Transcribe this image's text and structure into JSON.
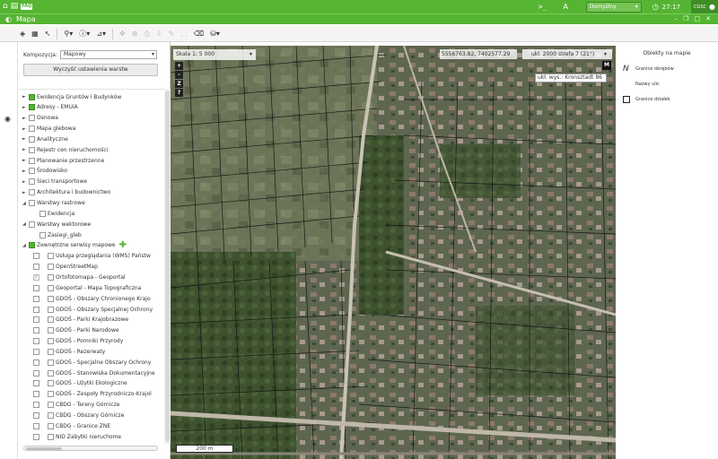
{
  "topbar": {
    "home_icon": "home-icon",
    "map_icon": "map-icon",
    "faq_label": "FAQ",
    "font_label": "A",
    "profile_label": "Domyślny",
    "time": "27:17",
    "user_label": "CGSC"
  },
  "titlebar": {
    "title": "Mapa"
  },
  "toolbar": {
    "icons": [
      "layers-icon",
      "table-icon",
      "pointer-icon",
      "search-icon",
      "info-icon",
      "measure-icon",
      "pan-icon",
      "zoom-icon",
      "print-icon",
      "export-icon",
      "draw-icon",
      "select-icon",
      "clear-icon",
      "database-icon"
    ]
  },
  "panel": {
    "kompozycja_label": "Kompozycja",
    "kompozycja_value": "Mapowy",
    "reset_button": "Wyczyść ustawienia warstw",
    "tree": [
      {
        "label": "Ewidencja Gruntów i Budynków",
        "toggle": "►",
        "check": "green",
        "indent": 0
      },
      {
        "label": "Adresy - EMUiA",
        "toggle": "►",
        "check": "green",
        "indent": 0
      },
      {
        "label": "Osnowa",
        "toggle": "►",
        "check": "empty",
        "indent": 0
      },
      {
        "label": "Mapa glebowa",
        "toggle": "►",
        "check": "empty",
        "indent": 0
      },
      {
        "label": "Analityczne",
        "toggle": "►",
        "check": "empty",
        "indent": 0
      },
      {
        "label": "Rejestr cen nieruchomości",
        "toggle": "►",
        "check": "empty",
        "indent": 0
      },
      {
        "label": "Planowanie przestrzenne",
        "toggle": "►",
        "check": "empty",
        "indent": 0
      },
      {
        "label": "Środowisko",
        "toggle": "►",
        "check": "empty",
        "indent": 0
      },
      {
        "label": "Sieci transportowe",
        "toggle": "►",
        "check": "empty",
        "indent": 0
      },
      {
        "label": "Architektura i budownictwo",
        "toggle": "►",
        "check": "empty",
        "indent": 0
      },
      {
        "label": "Warstwy rastrowe",
        "toggle": "◢",
        "check": "empty",
        "indent": 0
      },
      {
        "label": "Ewidencja",
        "toggle": "",
        "check": "empty",
        "indent": 1
      },
      {
        "label": "Warstwy wektorowe",
        "toggle": "◢",
        "check": "empty",
        "indent": 0
      },
      {
        "label": "Zasiegi_gleb",
        "toggle": "",
        "check": "empty",
        "indent": 1
      },
      {
        "label": "Zewnętrzne serwisy mapowe",
        "toggle": "◢",
        "check": "green",
        "indent": 0,
        "plus": "✚"
      },
      {
        "label": "Usługa przeglądania (WMS) Państw",
        "toggle": "",
        "check": "empty",
        "indent": 1,
        "pre": "empty"
      },
      {
        "label": "OpenStreetMap",
        "toggle": "",
        "check": "empty",
        "indent": 1,
        "pre": "empty"
      },
      {
        "label": "Ortofotomapa - Geoportal",
        "toggle": "",
        "check": "empty",
        "indent": 1,
        "pre": "gray"
      },
      {
        "label": "Geoportal - Mapa Topograficzna",
        "toggle": "",
        "check": "empty",
        "indent": 1,
        "pre": "empty"
      },
      {
        "label": "GDOŚ - Obszary Chronionego Krajo",
        "toggle": "",
        "check": "empty",
        "indent": 1,
        "pre": "empty"
      },
      {
        "label": "GDOŚ - Obszary Specjalnej Ochrony",
        "toggle": "",
        "check": "empty",
        "indent": 1,
        "pre": "empty"
      },
      {
        "label": "GDOŚ - Parki Krajobrazowe",
        "toggle": "",
        "check": "empty",
        "indent": 1,
        "pre": "empty"
      },
      {
        "label": "GDOŚ - Parki Narodowe",
        "toggle": "",
        "check": "empty",
        "indent": 1,
        "pre": "empty"
      },
      {
        "label": "GDOŚ - Pomniki Przyrody",
        "toggle": "",
        "check": "empty",
        "indent": 1,
        "pre": "empty"
      },
      {
        "label": "GDOŚ - Rezerwaty",
        "toggle": "",
        "check": "empty",
        "indent": 1,
        "pre": "empty"
      },
      {
        "label": "GDOŚ - Specjalne Obszary Ochrony",
        "toggle": "",
        "check": "empty",
        "indent": 1,
        "pre": "empty"
      },
      {
        "label": "GDOŚ - Stanowiska Dokumentacyjne",
        "toggle": "",
        "check": "empty",
        "indent": 1,
        "pre": "empty"
      },
      {
        "label": "GDOŚ - Użytki Ekologiczne",
        "toggle": "",
        "check": "empty",
        "indent": 1,
        "pre": "empty"
      },
      {
        "label": "GDOŚ - Zespoły Przyrodniczo-Krajol",
        "toggle": "",
        "check": "empty",
        "indent": 1,
        "pre": "empty"
      },
      {
        "label": "CBDG - Tereny Górnicze",
        "toggle": "",
        "check": "empty",
        "indent": 1,
        "pre": "empty"
      },
      {
        "label": "CBDG - Obszary Górnicze",
        "toggle": "",
        "check": "empty",
        "indent": 1,
        "pre": "empty"
      },
      {
        "label": "CBDG - Granice ZNE",
        "toggle": "",
        "check": "empty",
        "indent": 1,
        "pre": "empty"
      },
      {
        "label": "NID Zabytki nieruchome",
        "toggle": "",
        "check": "empty",
        "indent": 1,
        "pre": "empty"
      }
    ]
  },
  "map": {
    "scale_label": "Skala",
    "scale_value": "1: 5 000",
    "zoom_buttons": [
      "+",
      "-",
      "Z",
      "?"
    ],
    "coords": "5556763.82, 7402577.29",
    "crs": "ukł. 2000 strefa 7 (21°)",
    "m_button": "M",
    "height_label": "ukł. wys.: Kronsztadt 86",
    "scalebar": "200 m"
  },
  "legend": {
    "title": "Obiekty na mapie",
    "items": [
      {
        "symbol": "N",
        "label": "Granice obrębów"
      },
      {
        "symbol": "",
        "label": "Nazwy ulic"
      },
      {
        "symbol": "box",
        "label": "Granice działek"
      }
    ]
  }
}
